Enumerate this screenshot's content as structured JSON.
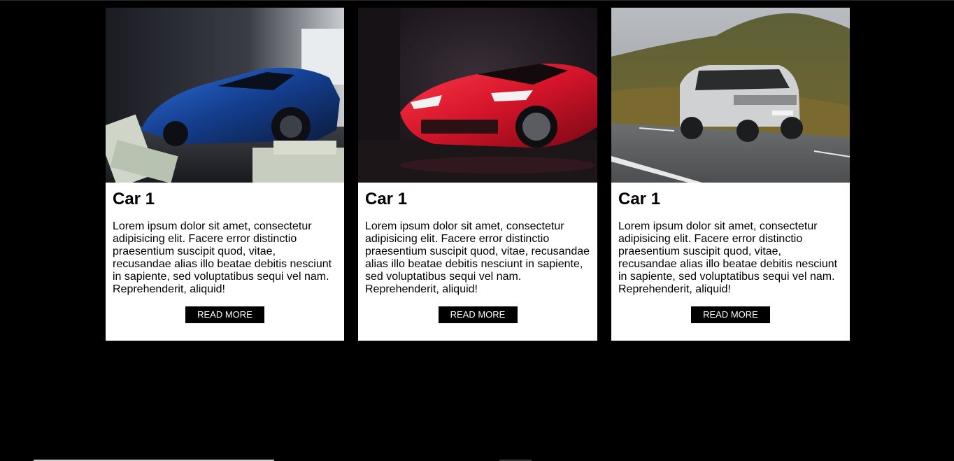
{
  "cards": [
    {
      "image_alt": "blue hypercar with stacks of cash",
      "title": "Car 1",
      "text": "Lorem ipsum dolor sit amet, consectetur adipisicing elit. Facere error distinctio praesentium suscipit quod, vitae, recusandae alias illo beatae debitis nesciunt in sapiente, sed voluptatibus sequi vel nam. Reprehenderit, aliquid!",
      "button_label": "READ MORE"
    },
    {
      "image_alt": "red sports car in dark studio",
      "title": "Car 1",
      "text": "Lorem ipsum dolor sit amet, consectetur adipisicing elit. Facere error distinctio praesentium suscipit quod, vitae, recusandae alias illo beatae debitis nesciunt in sapiente, sed voluptatibus sequi vel nam. Reprehenderit, aliquid!",
      "button_label": "READ MORE"
    },
    {
      "image_alt": "silver SUV driving on mountain road",
      "title": "Car 1",
      "text": "Lorem ipsum dolor sit amet, consectetur adipisicing elit. Facere error distinctio praesentium suscipit quod, vitae, recusandae alias illo beatae debitis nesciunt in sapiente, sed voluptatibus sequi vel nam. Reprehenderit, aliquid!",
      "button_label": "READ MORE"
    }
  ],
  "colors": {
    "background": "#000000",
    "card": "#ffffff",
    "button": "#000000",
    "button_text": "#ffffff"
  }
}
